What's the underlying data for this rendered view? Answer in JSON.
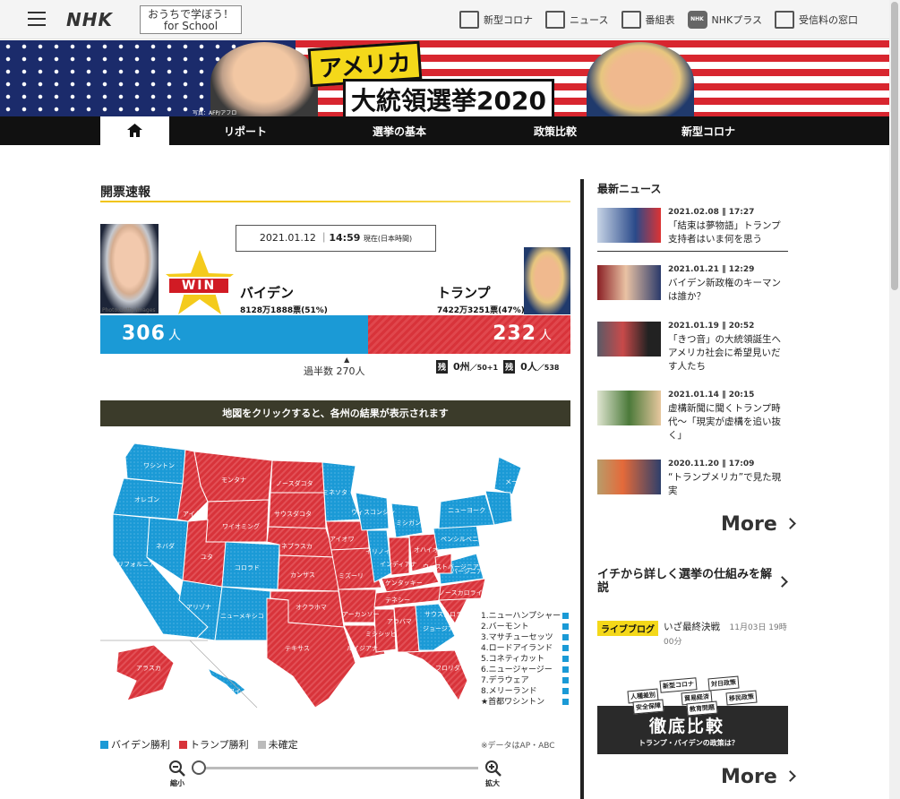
{
  "header": {
    "logo": "NHK",
    "school_line1": "おうちで学ぼう！",
    "school_line2": "for School",
    "nav": [
      {
        "label": "新型コロナ",
        "icon": "news-grid-icon"
      },
      {
        "label": "ニュース",
        "icon": "newspaper-icon"
      },
      {
        "label": "番組表",
        "icon": "tv-schedule-icon"
      },
      {
        "label": "NHKプラス",
        "icon": "nhk-plus-icon"
      },
      {
        "label": "受信料の窓口",
        "icon": "tv-icon"
      }
    ]
  },
  "banner": {
    "title_line1": "アメリカ",
    "title_line2": "大統領選挙2020",
    "credit": "写真：AFP/アフロ"
  },
  "main_nav": {
    "items": [
      "リポート",
      "選挙の基本",
      "政策比較",
      "新型コロナ"
    ]
  },
  "results": {
    "section_title": "開票速報",
    "timestamp_date": "2021.01.12",
    "timestamp_time": "14:59",
    "timestamp_note": "現在(日本時間)",
    "win_label": "WIN",
    "photo_credit": "Photo:Getty Images",
    "biden": {
      "name": "バイデン",
      "votes": "8128万1888票(51%)",
      "electoral": "306",
      "unit": "人",
      "color": "#1b9ad6"
    },
    "trump": {
      "name": "トランプ",
      "votes": "7422万3251票(47%)",
      "electoral": "232",
      "unit": "人",
      "color": "#d8333a"
    },
    "majority": "過半数 270人",
    "remaining_tag": "残",
    "remaining_states": "0州",
    "remaining_states_total": "／50+1",
    "remaining_people": "0人",
    "remaining_people_total": "／538",
    "biden_share": 0.569,
    "map_note": "地図をクリックすると、各州の結果が表示されます"
  },
  "map": {
    "state_labels": [
      "ワシントン",
      "オレゴン",
      "アイダホ",
      "モンタナ",
      "ノースダコタ",
      "ミネソタ",
      "ウィスコンシン",
      "ミシガン",
      "ワイオミング",
      "サウスダコタ",
      "ネブラスカ",
      "アイオワ",
      "ネバダ",
      "カリフォルニア",
      "ユタ",
      "コロラド",
      "カンザス",
      "ミズーリ",
      "イリノイ",
      "インディアナ",
      "オハイオ",
      "ペンシルベニア",
      "ニューヨーク",
      "メーン",
      "アリゾナ",
      "ニューメキシコ",
      "オクラホマ",
      "テキサス",
      "アーカンソー",
      "ルイジアナ",
      "ミシシッピ",
      "アラバマ",
      "ジョージア",
      "フロリダ",
      "テネシー",
      "ケンタッキー",
      "ウェストバージニア",
      "バージニア",
      "ノースカロライナ",
      "サウスカロライナ",
      "アラスカ",
      "ハワイ"
    ],
    "small_states": [
      "1.ニューハンプシャー",
      "2.バーモント",
      "3.マサチューセッツ",
      "4.ロードアイランド",
      "5.コネティカット",
      "6.ニュージャージー",
      "7.デラウェア",
      "8.メリーランド",
      "★首都ワシントン"
    ],
    "legend": [
      {
        "label": "バイデン勝利",
        "color": "#1b9ad6"
      },
      {
        "label": "トランプ勝利",
        "color": "#d8333a"
      },
      {
        "label": "未確定",
        "color": "#bbbbbb"
      }
    ],
    "source": "※データはAP・ABC",
    "zoom_out": "縮小",
    "zoom_in": "拡大",
    "zoom_level": 0
  },
  "sidebar": {
    "latest_title": "最新ニュース",
    "news": [
      {
        "date": "2021.02.08",
        "time": "17:27",
        "title": "「結束は夢物語」トランプ支持者はいま何を思う"
      },
      {
        "date": "2021.01.21",
        "time": "12:29",
        "title": "バイデン新政権のキーマンは誰か？"
      },
      {
        "date": "2021.01.19",
        "time": "20:52",
        "title": "「きつ音」の大統領誕生へ アメリカ社会に希望見いだす人たち"
      },
      {
        "date": "2021.01.14",
        "time": "20:15",
        "title": "虚構新聞に聞くトランプ時代～「現実が虚構を追い抜く」"
      },
      {
        "date": "2020.11.20",
        "time": "17:09",
        "title": "“トランプメリカ”で見た現実"
      }
    ],
    "more": "More",
    "explainer_title": "イチから詳しく選挙の仕組みを解説",
    "liveblog_tag": "ライブブログ",
    "liveblog_title": "いざ最終決戦",
    "liveblog_date": "11月03日 19時00分",
    "promo_chips": [
      "新型コロナ",
      "対日政策",
      "人種差別",
      "貿易経済",
      "移民政策",
      "安全保障",
      "教育問題"
    ],
    "promo_headline": "徹底比較",
    "promo_sub": "トランプ・バイデンの政策は？",
    "more2": "More"
  }
}
